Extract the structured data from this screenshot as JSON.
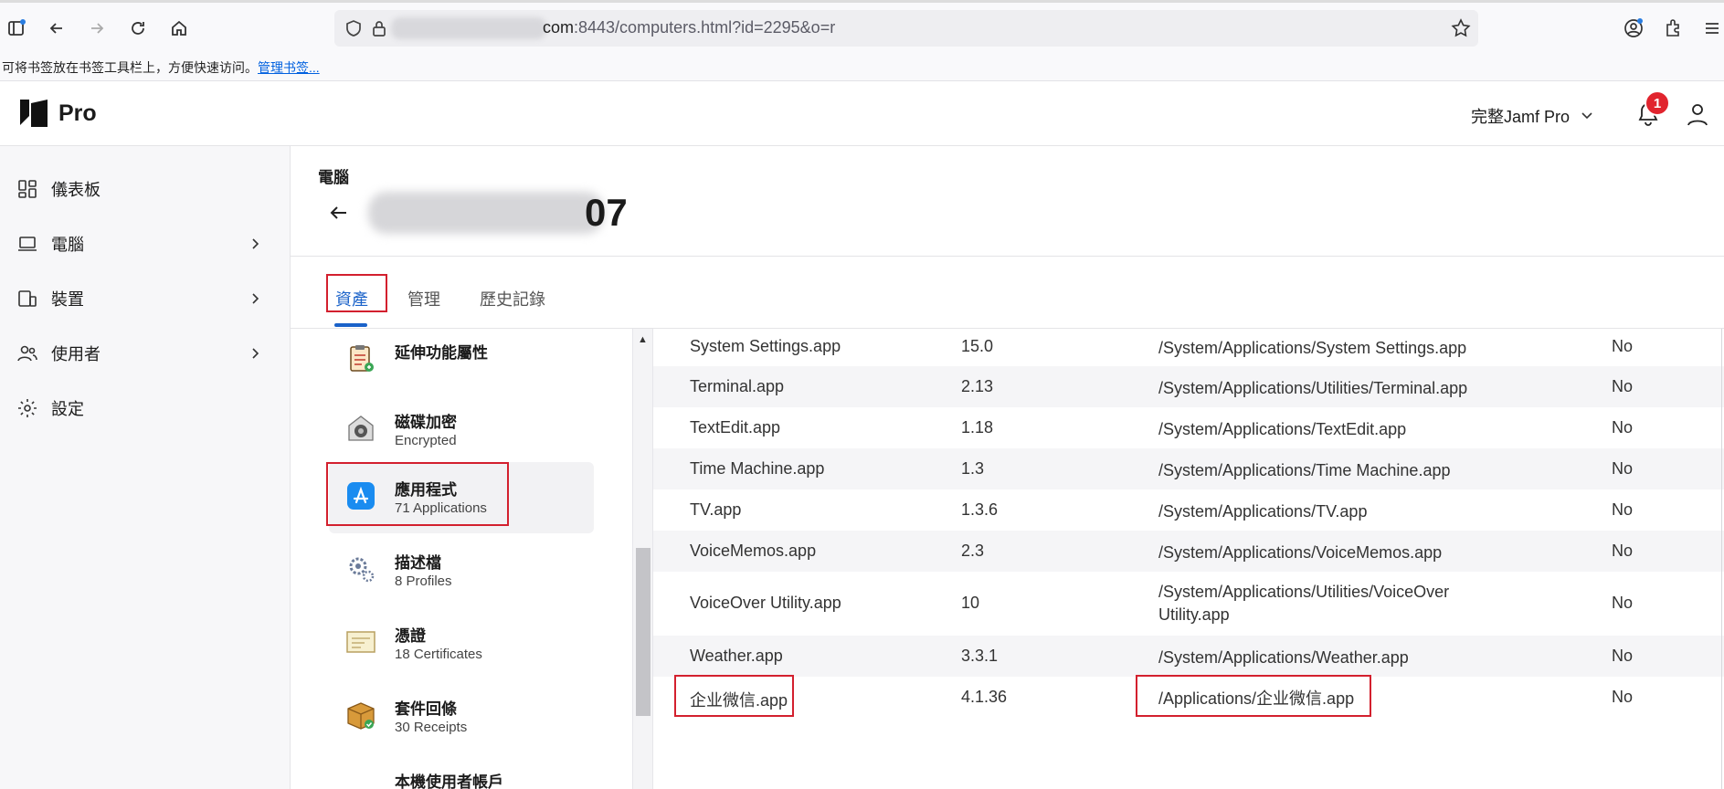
{
  "browser": {
    "url_host_suffix": "com",
    "url_path": ":8443/computers.html?id=2295&o=r",
    "bookmarks_text": "可将书签放在书签工具栏上，方便快速访问。",
    "bookmarks_link": "管理书签..."
  },
  "app": {
    "logo_text": "Pro",
    "org_label": "完整Jamf Pro",
    "notification_count": "1"
  },
  "sidebar": {
    "items": [
      {
        "label": "儀表板",
        "icon": "dashboard-icon"
      },
      {
        "label": "電腦",
        "icon": "laptop-icon"
      },
      {
        "label": "裝置",
        "icon": "devices-icon"
      },
      {
        "label": "使用者",
        "icon": "users-icon"
      },
      {
        "label": "設定",
        "icon": "gear-icon"
      }
    ]
  },
  "page": {
    "breadcrumb": "電腦",
    "title_suffix": "07"
  },
  "tabs": [
    {
      "label": "資產",
      "active": true
    },
    {
      "label": "管理",
      "active": false
    },
    {
      "label": "歷史記錄",
      "active": false
    }
  ],
  "categories": [
    {
      "name": "延伸功能屬性",
      "sub": ""
    },
    {
      "name": "磁碟加密",
      "sub": "Encrypted"
    },
    {
      "name": "應用程式",
      "sub": "71 Applications"
    },
    {
      "name": "描述檔",
      "sub": "8 Profiles"
    },
    {
      "name": "憑證",
      "sub": "18 Certificates"
    },
    {
      "name": "套件回條",
      "sub": "30 Receipts"
    },
    {
      "name": "本機使用者帳戶",
      "sub": ""
    }
  ],
  "applications": [
    {
      "name": "System Settings.app",
      "version": "15.0",
      "path": "/System/Applications/System Settings.app",
      "flag": "No"
    },
    {
      "name": "Terminal.app",
      "version": "2.13",
      "path": "/System/Applications/Utilities/Terminal.app",
      "flag": "No"
    },
    {
      "name": "TextEdit.app",
      "version": "1.18",
      "path": "/System/Applications/TextEdit.app",
      "flag": "No"
    },
    {
      "name": "Time Machine.app",
      "version": "1.3",
      "path": "/System/Applications/Time Machine.app",
      "flag": "No"
    },
    {
      "name": "TV.app",
      "version": "1.3.6",
      "path": "/System/Applications/TV.app",
      "flag": "No"
    },
    {
      "name": "VoiceMemos.app",
      "version": "2.3",
      "path": "/System/Applications/VoiceMemos.app",
      "flag": "No"
    },
    {
      "name": "VoiceOver Utility.app",
      "version": "10",
      "path": "/System/Applications/Utilities/VoiceOver Utility.app",
      "flag": "No"
    },
    {
      "name": "Weather.app",
      "version": "3.3.1",
      "path": "/System/Applications/Weather.app",
      "flag": "No"
    },
    {
      "name": "企业微信.app",
      "version": "4.1.36",
      "path": "/Applications/企业微信.app",
      "flag": "No"
    }
  ],
  "colors": {
    "accent": "#1a62c9",
    "highlight_box": "#d3202e",
    "badge": "#e1242e"
  }
}
